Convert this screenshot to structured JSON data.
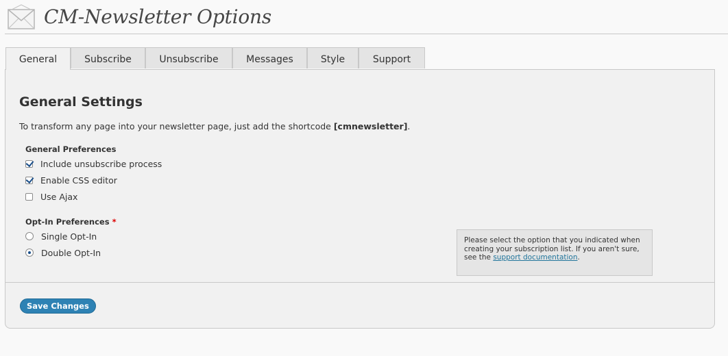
{
  "page": {
    "title": "CM-Newsletter Options"
  },
  "tabs": [
    {
      "label": "General",
      "active": true
    },
    {
      "label": "Subscribe",
      "active": false
    },
    {
      "label": "Unsubscribe",
      "active": false
    },
    {
      "label": "Messages",
      "active": false
    },
    {
      "label": "Style",
      "active": false
    },
    {
      "label": "Support",
      "active": false
    }
  ],
  "general": {
    "section_title": "General Settings",
    "intro_text": "To transform any page into your newsletter page, just add the shortcode ",
    "shortcode": "[cmnewsletter]",
    "intro_end": ".",
    "preferences": {
      "label": "General Preferences",
      "options": [
        {
          "label": "Include unsubscribe process",
          "checked": true
        },
        {
          "label": "Enable CSS editor",
          "checked": true
        },
        {
          "label": "Use Ajax",
          "checked": false
        }
      ]
    },
    "optin": {
      "label": "Opt-In Preferences",
      "required_marker": "*",
      "options": [
        {
          "label": "Single Opt-In",
          "selected": false
        },
        {
          "label": "Double Opt-In",
          "selected": true
        }
      ]
    },
    "help": {
      "text_before": "Please select the option that you indicated when creating your subscription list. If you aren't sure, see the ",
      "link_text": "support documentation",
      "text_after": "."
    }
  },
  "actions": {
    "save_label": "Save Changes"
  },
  "colors": {
    "accent": "#2e82b4",
    "link": "#21759b",
    "required": "#dd0000"
  }
}
